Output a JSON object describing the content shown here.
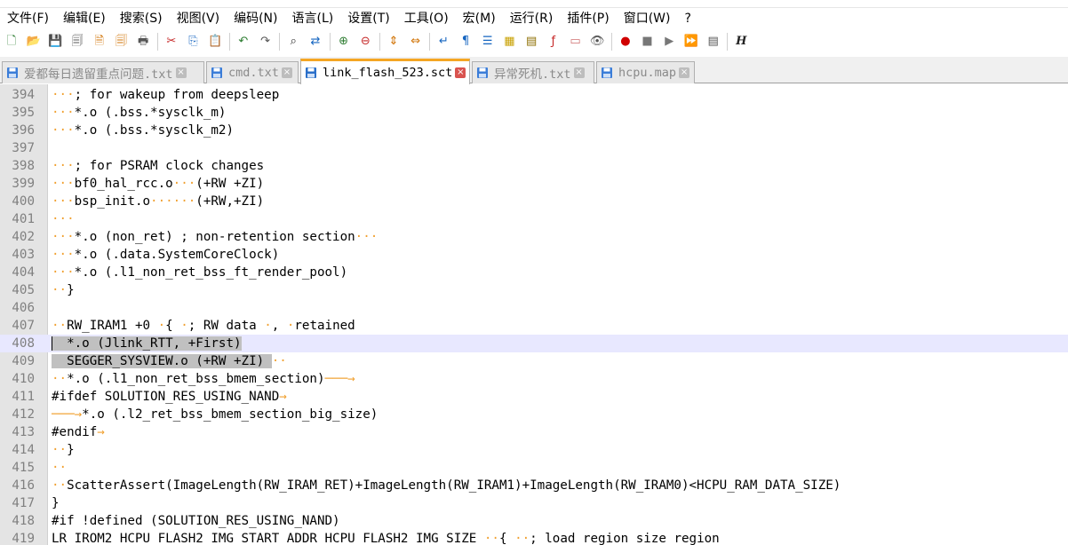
{
  "menu": [
    {
      "label": "文件(F)"
    },
    {
      "label": "编辑(E)"
    },
    {
      "label": "搜索(S)"
    },
    {
      "label": "视图(V)"
    },
    {
      "label": "编码(N)"
    },
    {
      "label": "语言(L)"
    },
    {
      "label": "设置(T)"
    },
    {
      "label": "工具(O)"
    },
    {
      "label": "宏(M)"
    },
    {
      "label": "运行(R)"
    },
    {
      "label": "插件(P)"
    },
    {
      "label": "窗口(W)"
    },
    {
      "label": "?"
    }
  ],
  "toolbar": {
    "groups": [
      [
        {
          "icon": "new-file-icon",
          "glyph": "🗋",
          "color": "#2e7d32"
        },
        {
          "icon": "open-file-icon",
          "glyph": "📂",
          "color": "#c8a000"
        },
        {
          "icon": "save-icon",
          "glyph": "💾",
          "color": "#555"
        },
        {
          "icon": "save-all-icon",
          "glyph": "🗐",
          "color": "#555"
        },
        {
          "icon": "close-icon",
          "glyph": "🗎",
          "color": "#d07000"
        },
        {
          "icon": "close-all-icon",
          "glyph": "🗐",
          "color": "#d07000"
        },
        {
          "icon": "print-icon",
          "glyph": "🖶",
          "color": "#555"
        }
      ],
      [
        {
          "icon": "cut-icon",
          "glyph": "✂",
          "color": "#c62828"
        },
        {
          "icon": "copy-icon",
          "glyph": "⎘",
          "color": "#1565c0"
        },
        {
          "icon": "paste-icon",
          "glyph": "📋",
          "color": "#8d6e00"
        }
      ],
      [
        {
          "icon": "undo-icon",
          "glyph": "↶",
          "color": "#2e7d32"
        },
        {
          "icon": "redo-icon",
          "glyph": "↷",
          "color": "#555"
        }
      ],
      [
        {
          "icon": "find-icon",
          "glyph": "⌕",
          "color": "#333"
        },
        {
          "icon": "replace-icon",
          "glyph": "⇄",
          "color": "#1565c0"
        }
      ],
      [
        {
          "icon": "zoom-in-icon",
          "glyph": "⊕",
          "color": "#2e7d32"
        },
        {
          "icon": "zoom-out-icon",
          "glyph": "⊖",
          "color": "#c62828"
        }
      ],
      [
        {
          "icon": "sync-vertical-icon",
          "glyph": "⇕",
          "color": "#d07000"
        },
        {
          "icon": "sync-horizontal-icon",
          "glyph": "⇔",
          "color": "#d07000"
        }
      ],
      [
        {
          "icon": "word-wrap-icon",
          "glyph": "↵",
          "color": "#1565c0"
        },
        {
          "icon": "show-all-chars-icon",
          "glyph": "¶",
          "color": "#1565c0"
        },
        {
          "icon": "indent-guide-icon",
          "glyph": "☰",
          "color": "#1565c0"
        },
        {
          "icon": "doc-map-icon",
          "glyph": "▦",
          "color": "#c8a000"
        },
        {
          "icon": "function-list-icon",
          "glyph": "▤",
          "color": "#8d6e00"
        },
        {
          "icon": "doc-list-icon",
          "glyph": "ƒ",
          "color": "#c62828"
        },
        {
          "icon": "folder-workspace-icon",
          "glyph": "▭",
          "color": "#d07070"
        },
        {
          "icon": "monitor-icon",
          "glyph": "👁",
          "color": "#555"
        }
      ],
      [
        {
          "icon": "record-macro-icon",
          "glyph": "●",
          "color": "#d00000"
        },
        {
          "icon": "stop-macro-icon",
          "glyph": "■",
          "color": "#777"
        },
        {
          "icon": "play-macro-icon",
          "glyph": "▶",
          "color": "#777"
        },
        {
          "icon": "run-macro-multiple-icon",
          "glyph": "⏩",
          "color": "#1565c0"
        },
        {
          "icon": "save-macro-icon",
          "glyph": "▤",
          "color": "#555"
        }
      ],
      [
        {
          "icon": "spell-check-icon",
          "glyph": "H",
          "color": "#222"
        }
      ]
    ]
  },
  "tabs": [
    {
      "label": "爱都每日遗留重点问题.txt",
      "close": "×",
      "active": false
    },
    {
      "label": "cmd.txt",
      "close": "×",
      "active": false
    },
    {
      "label": "link_flash_523.sct",
      "close": "×",
      "active": true
    },
    {
      "label": "异常死机.txt",
      "close": "×",
      "active": false
    },
    {
      "label": "hcpu.map",
      "close": "×",
      "active": false
    }
  ],
  "editor": {
    "lines": [
      {
        "number": "394",
        "segments": [
          {
            "t": "···",
            "w": 1
          },
          {
            "t": "; for wakeup from deepsleep"
          }
        ]
      },
      {
        "number": "395",
        "segments": [
          {
            "t": "···",
            "w": 1
          },
          {
            "t": "*.o (.bss.*sysclk_m)"
          }
        ]
      },
      {
        "number": "396",
        "segments": [
          {
            "t": "···",
            "w": 1
          },
          {
            "t": "*.o (.bss.*sysclk_m2)"
          }
        ]
      },
      {
        "number": "397",
        "segments": []
      },
      {
        "number": "398",
        "segments": [
          {
            "t": "···",
            "w": 1
          },
          {
            "t": "; for PSRAM clock changes"
          }
        ]
      },
      {
        "number": "399",
        "segments": [
          {
            "t": "···",
            "w": 1
          },
          {
            "t": "bf0_hal_rcc.o"
          },
          {
            "t": "···",
            "w": 1
          },
          {
            "t": "(+RW +ZI)"
          }
        ]
      },
      {
        "number": "400",
        "segments": [
          {
            "t": "···",
            "w": 1
          },
          {
            "t": "bsp_init.o"
          },
          {
            "t": "······",
            "w": 1
          },
          {
            "t": "(+RW,+ZI)"
          }
        ]
      },
      {
        "number": "401",
        "segments": [
          {
            "t": "···",
            "w": 1
          }
        ]
      },
      {
        "number": "402",
        "segments": [
          {
            "t": "···",
            "w": 1
          },
          {
            "t": "*.o (non_ret) ; non-retention section"
          },
          {
            "t": "···",
            "w": 1
          }
        ]
      },
      {
        "number": "403",
        "segments": [
          {
            "t": "···",
            "w": 1
          },
          {
            "t": "*.o (.data.SystemCoreClock)"
          }
        ]
      },
      {
        "number": "404",
        "segments": [
          {
            "t": "···",
            "w": 1
          },
          {
            "t": "*.o (.l1_non_ret_bss_ft_render_pool)"
          }
        ]
      },
      {
        "number": "405",
        "segments": [
          {
            "t": "··",
            "w": 1
          },
          {
            "t": "}"
          }
        ]
      },
      {
        "number": "406",
        "segments": []
      },
      {
        "number": "407",
        "segments": [
          {
            "t": "··",
            "w": 1
          },
          {
            "t": "RW_IRAM1 +0 "
          },
          {
            "t": "·",
            "w": 1
          },
          {
            "t": "{ "
          },
          {
            "t": "·",
            "w": 1
          },
          {
            "t": "; RW data "
          },
          {
            "t": "·",
            "w": 1
          },
          {
            "t": ", "
          },
          {
            "t": "·",
            "w": 1
          },
          {
            "t": "retained"
          }
        ]
      },
      {
        "number": "408",
        "current": true,
        "segments": [
          {
            "t": "  *.o (Jlink_RTT, +First)",
            "sel": 1
          }
        ]
      },
      {
        "number": "409",
        "segments": [
          {
            "t": "  SEGGER_SYSVIEW.o (+RW +ZI) ",
            "sel": 1
          },
          {
            "t": "··",
            "w": 1
          }
        ]
      },
      {
        "number": "410",
        "segments": [
          {
            "t": "··",
            "w": 1
          },
          {
            "t": "*.o (.l1_non_ret_bss_bmem_section)"
          },
          {
            "t": "───→",
            "w": 1
          }
        ]
      },
      {
        "number": "411",
        "segments": [
          {
            "t": "#ifdef SOLUTION_RES_USING_NAND"
          },
          {
            "t": "→",
            "w": 1
          }
        ]
      },
      {
        "number": "412",
        "segments": [
          {
            "t": "───→",
            "w": 1
          },
          {
            "t": "*.o (.l2_ret_bss_bmem_section_big_size)"
          }
        ]
      },
      {
        "number": "413",
        "segments": [
          {
            "t": "#endif"
          },
          {
            "t": "→",
            "w": 1
          }
        ]
      },
      {
        "number": "414",
        "segments": [
          {
            "t": "··",
            "w": 1
          },
          {
            "t": "}"
          }
        ]
      },
      {
        "number": "415",
        "segments": [
          {
            "t": "··",
            "w": 1
          }
        ]
      },
      {
        "number": "416",
        "segments": [
          {
            "t": "··",
            "w": 1
          },
          {
            "t": "ScatterAssert(ImageLength(RW_IRAM_RET)+ImageLength(RW_IRAM1)+ImageLength(RW_IRAM0)<HCPU_RAM_DATA_SIZE)"
          }
        ]
      },
      {
        "number": "417",
        "segments": [
          {
            "t": "}"
          }
        ]
      },
      {
        "number": "418",
        "segments": [
          {
            "t": "#if !defined "
          },
          {
            "t": "(SOLUTION_RES_USING_NAND)"
          }
        ]
      },
      {
        "number": "419",
        "segments": [
          {
            "t": "LR_IROM2 HCPU_FLASH2_IMG_START_ADDR HCPU_FLASH2_IMG_SIZE "
          },
          {
            "t": "··",
            "w": 1
          },
          {
            "t": "{ "
          },
          {
            "t": "··",
            "w": 1
          },
          {
            "t": "; load region size region"
          }
        ]
      }
    ]
  }
}
